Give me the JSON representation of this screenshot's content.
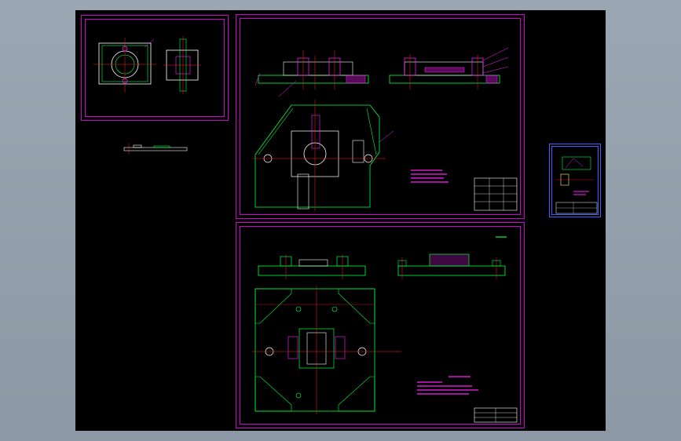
{
  "colors": {
    "background": "#000000",
    "frame": "#d000d0",
    "outline": "#00ff40",
    "center": "#ff2020",
    "detail": "#ff20ff",
    "white": "#ffffff",
    "viewer": "#8c98a5"
  },
  "sheets": [
    {
      "id": "sheet-small-topleft",
      "kind": "part drawing"
    },
    {
      "id": "sheet-assembly-top",
      "kind": "assembly drawing"
    },
    {
      "id": "sheet-assembly-bottom",
      "kind": "assembly drawing"
    },
    {
      "id": "sheet-thumbnail-right",
      "kind": "part drawing"
    }
  ]
}
